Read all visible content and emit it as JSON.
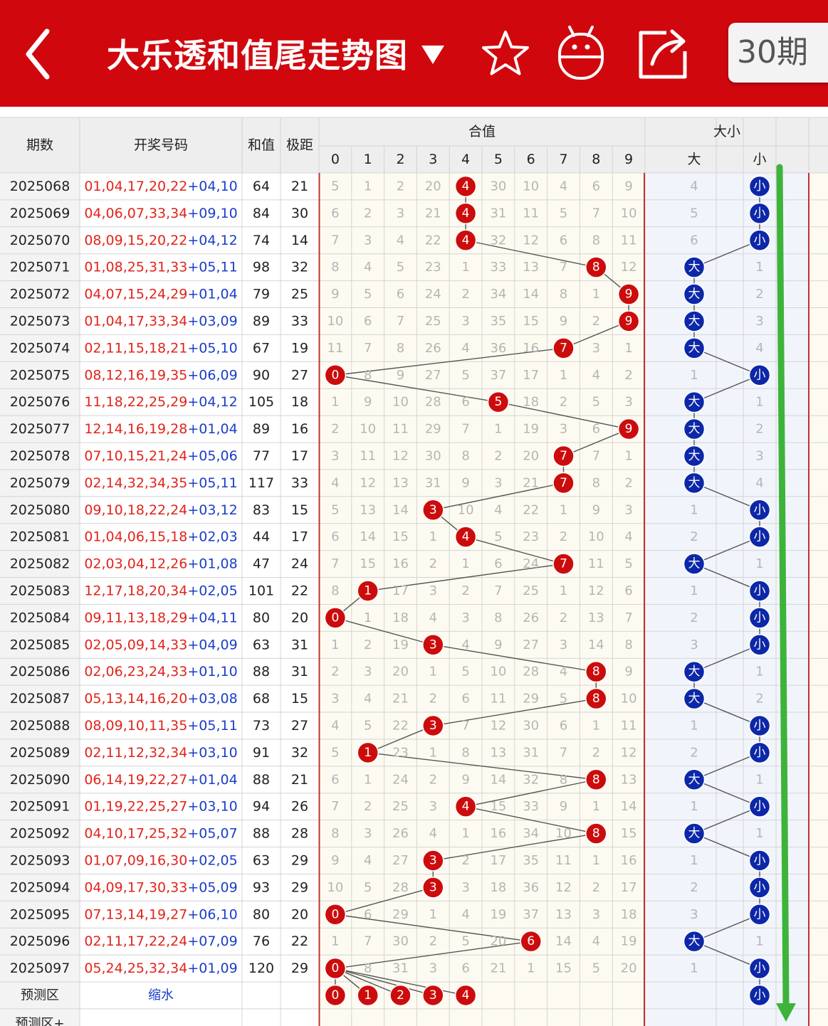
{
  "header": {
    "back_icon": "chevron-left-icon",
    "title": "大乐透和值尾走势图",
    "title_dropdown_icon": "caret-down-icon",
    "favorite_icon": "star-icon",
    "robot_icon": "robot-icon",
    "share_icon": "share-icon",
    "period_select": "30期"
  },
  "colors": {
    "brand_red": "#d0080e",
    "ball_red": "#cc0c0c",
    "ball_blue": "#0c27a8",
    "trend_arrow_green": "#3db33a",
    "number_red": "#e2231a",
    "number_blue": "#1a3ec9"
  },
  "table": {
    "columns": {
      "period": "期数",
      "numbers": "开奖号码",
      "sum": "和值",
      "range": "极距",
      "tail_group": "合值",
      "size_group": "大小",
      "big": "大",
      "small": "小"
    },
    "tail_digits": [
      "0",
      "1",
      "2",
      "3",
      "4",
      "5",
      "6",
      "7",
      "8",
      "9"
    ],
    "rows": [
      {
        "period": "2025068",
        "front": "01,04,17,20,22",
        "back": "+04,10",
        "sum": "64",
        "range": "21",
        "tail": 4,
        "tail_miss": [
          "5",
          "1",
          "2",
          "20",
          "4",
          "30",
          "10",
          "4",
          "6",
          "9"
        ],
        "size": "小",
        "size_miss": [
          "4",
          "小"
        ]
      },
      {
        "period": "2025069",
        "front": "04,06,07,33,34",
        "back": "+09,10",
        "sum": "84",
        "range": "30",
        "tail": 4,
        "tail_miss": [
          "6",
          "2",
          "3",
          "21",
          "4",
          "31",
          "11",
          "5",
          "7",
          "10"
        ],
        "size": "小",
        "size_miss": [
          "5",
          "小"
        ]
      },
      {
        "period": "2025070",
        "front": "08,09,15,20,22",
        "back": "+04,12",
        "sum": "74",
        "range": "14",
        "tail": 4,
        "tail_miss": [
          "7",
          "3",
          "4",
          "22",
          "4",
          "32",
          "12",
          "6",
          "8",
          "11"
        ],
        "size": "小",
        "size_miss": [
          "6",
          "小"
        ]
      },
      {
        "period": "2025071",
        "front": "01,08,25,31,33",
        "back": "+05,11",
        "sum": "98",
        "range": "32",
        "tail": 8,
        "tail_miss": [
          "8",
          "4",
          "5",
          "23",
          "1",
          "33",
          "13",
          "7",
          "8",
          "12"
        ],
        "size": "大",
        "size_miss": [
          "大",
          "1"
        ]
      },
      {
        "period": "2025072",
        "front": "04,07,15,24,29",
        "back": "+01,04",
        "sum": "79",
        "range": "25",
        "tail": 9,
        "tail_miss": [
          "9",
          "5",
          "6",
          "24",
          "2",
          "34",
          "14",
          "8",
          "1",
          "9"
        ],
        "size": "大",
        "size_miss": [
          "大",
          "2"
        ]
      },
      {
        "period": "2025073",
        "front": "01,04,17,33,34",
        "back": "+03,09",
        "sum": "89",
        "range": "33",
        "tail": 9,
        "tail_miss": [
          "10",
          "6",
          "7",
          "25",
          "3",
          "35",
          "15",
          "9",
          "2",
          "9"
        ],
        "size": "大",
        "size_miss": [
          "大",
          "3"
        ]
      },
      {
        "period": "2025074",
        "front": "02,11,15,18,21",
        "back": "+05,10",
        "sum": "67",
        "range": "19",
        "tail": 7,
        "tail_miss": [
          "11",
          "7",
          "8",
          "26",
          "4",
          "36",
          "16",
          "7",
          "3",
          "1"
        ],
        "size": "大",
        "size_miss": [
          "大",
          "4"
        ]
      },
      {
        "period": "2025075",
        "front": "08,12,16,19,35",
        "back": "+06,09",
        "sum": "90",
        "range": "27",
        "tail": 0,
        "tail_miss": [
          "0",
          "8",
          "9",
          "27",
          "5",
          "37",
          "17",
          "1",
          "4",
          "2"
        ],
        "size": "小",
        "size_miss": [
          "1",
          "小"
        ]
      },
      {
        "period": "2025076",
        "front": "11,18,22,25,29",
        "back": "+04,12",
        "sum": "105",
        "range": "18",
        "tail": 5,
        "tail_miss": [
          "1",
          "9",
          "10",
          "28",
          "6",
          "5",
          "18",
          "2",
          "5",
          "3"
        ],
        "size": "大",
        "size_miss": [
          "大",
          "1"
        ]
      },
      {
        "period": "2025077",
        "front": "12,14,16,19,28",
        "back": "+01,04",
        "sum": "89",
        "range": "16",
        "tail": 9,
        "tail_miss": [
          "2",
          "10",
          "11",
          "29",
          "7",
          "1",
          "19",
          "3",
          "6",
          "9"
        ],
        "size": "大",
        "size_miss": [
          "大",
          "2"
        ]
      },
      {
        "period": "2025078",
        "front": "07,10,15,21,24",
        "back": "+05,06",
        "sum": "77",
        "range": "17",
        "tail": 7,
        "tail_miss": [
          "3",
          "11",
          "12",
          "30",
          "8",
          "2",
          "20",
          "7",
          "7",
          "1"
        ],
        "size": "大",
        "size_miss": [
          "大",
          "3"
        ]
      },
      {
        "period": "2025079",
        "front": "02,14,32,34,35",
        "back": "+05,11",
        "sum": "117",
        "range": "33",
        "tail": 7,
        "tail_miss": [
          "4",
          "12",
          "13",
          "31",
          "9",
          "3",
          "21",
          "7",
          "8",
          "2"
        ],
        "size": "大",
        "size_miss": [
          "大",
          "4"
        ]
      },
      {
        "period": "2025080",
        "front": "09,10,18,22,24",
        "back": "+03,12",
        "sum": "83",
        "range": "15",
        "tail": 3,
        "tail_miss": [
          "5",
          "13",
          "14",
          "3",
          "10",
          "4",
          "22",
          "1",
          "9",
          "3"
        ],
        "size": "小",
        "size_miss": [
          "1",
          "小"
        ]
      },
      {
        "period": "2025081",
        "front": "01,04,06,15,18",
        "back": "+02,03",
        "sum": "44",
        "range": "17",
        "tail": 4,
        "tail_miss": [
          "6",
          "14",
          "15",
          "1",
          "4",
          "5",
          "23",
          "2",
          "10",
          "4"
        ],
        "size": "小",
        "size_miss": [
          "2",
          "小"
        ]
      },
      {
        "period": "2025082",
        "front": "02,03,04,12,26",
        "back": "+01,08",
        "sum": "47",
        "range": "24",
        "tail": 7,
        "tail_miss": [
          "7",
          "15",
          "16",
          "2",
          "1",
          "6",
          "24",
          "7",
          "11",
          "5"
        ],
        "size": "大",
        "size_miss": [
          "大",
          "1"
        ]
      },
      {
        "period": "2025083",
        "front": "12,17,18,20,34",
        "back": "+02,05",
        "sum": "101",
        "range": "22",
        "tail": 1,
        "tail_miss": [
          "8",
          "1",
          "17",
          "3",
          "2",
          "7",
          "25",
          "1",
          "12",
          "6"
        ],
        "size": "小",
        "size_miss": [
          "1",
          "小"
        ]
      },
      {
        "period": "2025084",
        "front": "09,11,13,18,29",
        "back": "+04,11",
        "sum": "80",
        "range": "20",
        "tail": 0,
        "tail_miss": [
          "0",
          "1",
          "18",
          "4",
          "3",
          "8",
          "26",
          "2",
          "13",
          "7"
        ],
        "size": "小",
        "size_miss": [
          "2",
          "小"
        ]
      },
      {
        "period": "2025085",
        "front": "02,05,09,14,33",
        "back": "+04,09",
        "sum": "63",
        "range": "31",
        "tail": 3,
        "tail_miss": [
          "1",
          "2",
          "19",
          "3",
          "4",
          "9",
          "27",
          "3",
          "14",
          "8"
        ],
        "size": "小",
        "size_miss": [
          "3",
          "小"
        ]
      },
      {
        "period": "2025086",
        "front": "02,06,23,24,33",
        "back": "+01,10",
        "sum": "88",
        "range": "31",
        "tail": 8,
        "tail_miss": [
          "2",
          "3",
          "20",
          "1",
          "5",
          "10",
          "28",
          "4",
          "8",
          "9"
        ],
        "size": "大",
        "size_miss": [
          "大",
          "1"
        ]
      },
      {
        "period": "2025087",
        "front": "05,13,14,16,20",
        "back": "+03,08",
        "sum": "68",
        "range": "15",
        "tail": 8,
        "tail_miss": [
          "3",
          "4",
          "21",
          "2",
          "6",
          "11",
          "29",
          "5",
          "8",
          "10"
        ],
        "size": "大",
        "size_miss": [
          "大",
          "2"
        ]
      },
      {
        "period": "2025088",
        "front": "08,09,10,11,35",
        "back": "+05,11",
        "sum": "73",
        "range": "27",
        "tail": 3,
        "tail_miss": [
          "4",
          "5",
          "22",
          "3",
          "7",
          "12",
          "30",
          "6",
          "1",
          "11"
        ],
        "size": "小",
        "size_miss": [
          "1",
          "小"
        ]
      },
      {
        "period": "2025089",
        "front": "02,11,12,32,34",
        "back": "+03,10",
        "sum": "91",
        "range": "32",
        "tail": 1,
        "tail_miss": [
          "5",
          "1",
          "23",
          "1",
          "8",
          "13",
          "31",
          "7",
          "2",
          "12"
        ],
        "size": "小",
        "size_miss": [
          "2",
          "小"
        ]
      },
      {
        "period": "2025090",
        "front": "06,14,19,22,27",
        "back": "+01,04",
        "sum": "88",
        "range": "21",
        "tail": 8,
        "tail_miss": [
          "6",
          "1",
          "24",
          "2",
          "9",
          "14",
          "32",
          "8",
          "8",
          "13"
        ],
        "size": "大",
        "size_miss": [
          "大",
          "1"
        ]
      },
      {
        "period": "2025091",
        "front": "01,19,22,25,27",
        "back": "+03,10",
        "sum": "94",
        "range": "26",
        "tail": 4,
        "tail_miss": [
          "7",
          "2",
          "25",
          "3",
          "4",
          "15",
          "33",
          "9",
          "1",
          "14"
        ],
        "size": "小",
        "size_miss": [
          "1",
          "小"
        ]
      },
      {
        "period": "2025092",
        "front": "04,10,17,25,32",
        "back": "+05,07",
        "sum": "88",
        "range": "28",
        "tail": 8,
        "tail_miss": [
          "8",
          "3",
          "26",
          "4",
          "1",
          "16",
          "34",
          "10",
          "8",
          "15"
        ],
        "size": "大",
        "size_miss": [
          "大",
          "1"
        ]
      },
      {
        "period": "2025093",
        "front": "01,07,09,16,30",
        "back": "+02,05",
        "sum": "63",
        "range": "29",
        "tail": 3,
        "tail_miss": [
          "9",
          "4",
          "27",
          "3",
          "2",
          "17",
          "35",
          "11",
          "1",
          "16"
        ],
        "size": "小",
        "size_miss": [
          "1",
          "小"
        ]
      },
      {
        "period": "2025094",
        "front": "04,09,17,30,33",
        "back": "+05,09",
        "sum": "93",
        "range": "29",
        "tail": 3,
        "tail_miss": [
          "10",
          "5",
          "28",
          "3",
          "3",
          "18",
          "36",
          "12",
          "2",
          "17"
        ],
        "size": "小",
        "size_miss": [
          "2",
          "小"
        ]
      },
      {
        "period": "2025095",
        "front": "07,13,14,19,27",
        "back": "+06,10",
        "sum": "80",
        "range": "20",
        "tail": 0,
        "tail_miss": [
          "0",
          "6",
          "29",
          "1",
          "4",
          "19",
          "37",
          "13",
          "3",
          "18"
        ],
        "size": "小",
        "size_miss": [
          "3",
          "小"
        ]
      },
      {
        "period": "2025096",
        "front": "02,11,17,22,24",
        "back": "+07,09",
        "sum": "76",
        "range": "22",
        "tail": 6,
        "tail_miss": [
          "1",
          "7",
          "30",
          "2",
          "5",
          "20",
          "6",
          "14",
          "4",
          "19"
        ],
        "size": "大",
        "size_miss": [
          "大",
          "1"
        ]
      },
      {
        "period": "2025097",
        "front": "05,24,25,32,34",
        "back": "+01,09",
        "sum": "120",
        "range": "29",
        "tail": 0,
        "tail_miss": [
          "0",
          "8",
          "31",
          "3",
          "6",
          "21",
          "1",
          "15",
          "5",
          "20"
        ],
        "size": "小",
        "size_miss": [
          "1",
          "小"
        ]
      }
    ],
    "forecast_row": {
      "label": "预测区",
      "shrink_label": "缩水",
      "tail_picks": [
        "0",
        "1",
        "2",
        "3",
        "4"
      ],
      "size_pick": "小"
    },
    "forecast_plus_label": "预测区+"
  }
}
